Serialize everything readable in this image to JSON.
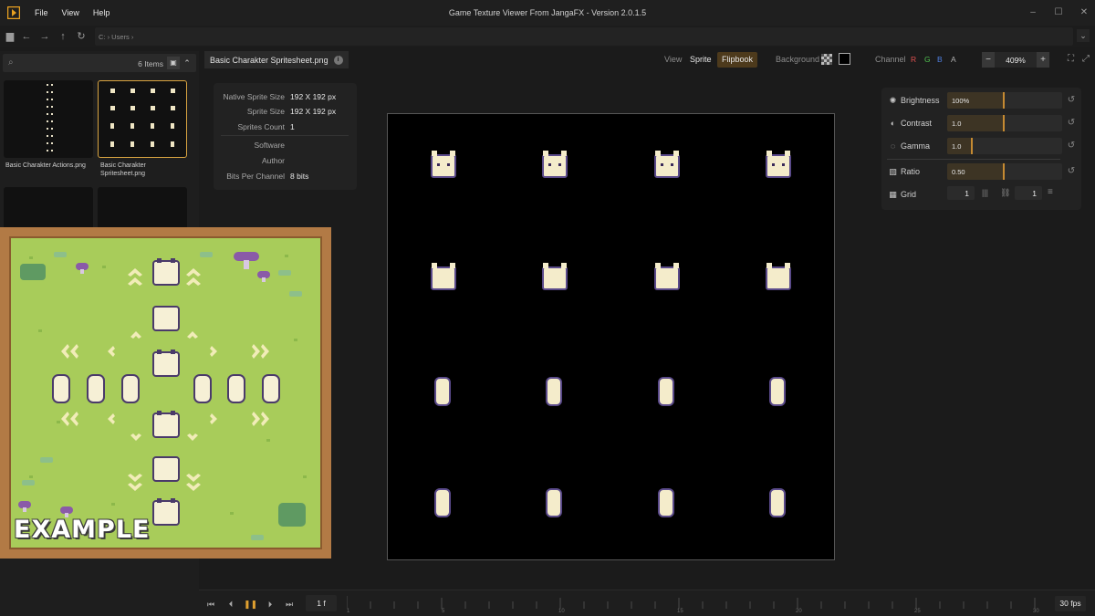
{
  "app": {
    "title": "Game Texture Viewer From JangaFX - Version 2.0.1.5",
    "menu": [
      "File",
      "View",
      "Help"
    ],
    "accent": "#d9a441"
  },
  "address": {
    "path": "C:  ›  Users  ›"
  },
  "browser": {
    "items_count": "6 Items",
    "files": [
      {
        "label": "Basic Charakter Actions.png",
        "selected": false
      },
      {
        "label": "Basic Charakter Spritesheet.png",
        "selected": true
      }
    ]
  },
  "example_label": "EXAMPLE",
  "toolbar": {
    "file_name": "Basic Charakter Spritesheet.png",
    "view_label": "View",
    "sprite_label": "Sprite",
    "flipbook_label": "Flipbook",
    "background_label": "Background",
    "channel_label": "Channel",
    "channels": [
      {
        "label": "R",
        "color": "#e05050"
      },
      {
        "label": "G",
        "color": "#50c050"
      },
      {
        "label": "B",
        "color": "#4f7fe0"
      },
      {
        "label": "A",
        "color": "#b0b0b0"
      }
    ],
    "zoom": "409%"
  },
  "info": {
    "rows": [
      {
        "key": "Native Sprite Size",
        "value": "192 X 192 px"
      },
      {
        "key": "Sprite Size",
        "value": "192 X 192 px"
      },
      {
        "key": "Sprites Count",
        "value": "1"
      },
      {
        "key": "Software",
        "value": ""
      },
      {
        "key": "Author",
        "value": ""
      },
      {
        "key": "Bits Per Channel",
        "value": "8 bits"
      }
    ]
  },
  "adjust": {
    "brightness": {
      "label": "Brightness",
      "value": "100%",
      "level": 0.5
    },
    "contrast": {
      "label": "Contrast",
      "value": "1.0",
      "level": 0.5
    },
    "gamma": {
      "label": "Gamma",
      "value": "1.0",
      "level": 0.22
    },
    "ratio": {
      "label": "Ratio",
      "value": "0.50",
      "level": 0.5
    },
    "grid": {
      "label": "Grid",
      "cols": "1",
      "rows": "1"
    }
  },
  "playback": {
    "frame": "1 f",
    "fps": "30 fps",
    "ticks": [
      "1",
      "5",
      "10",
      "15",
      "20",
      "25",
      "30"
    ]
  },
  "icons": [
    "app-logo-icon",
    "folder-icon",
    "back-icon",
    "forward-icon",
    "up-icon",
    "refresh-icon",
    "search-icon",
    "image-icon",
    "info-icon",
    "checker-icon",
    "brightness-icon",
    "contrast-icon",
    "gamma-icon",
    "ratio-icon",
    "grid-icon",
    "reset-icon",
    "link-icon",
    "skip-start-icon",
    "step-back-icon",
    "pause-icon",
    "step-forward-icon",
    "skip-end-icon"
  ]
}
